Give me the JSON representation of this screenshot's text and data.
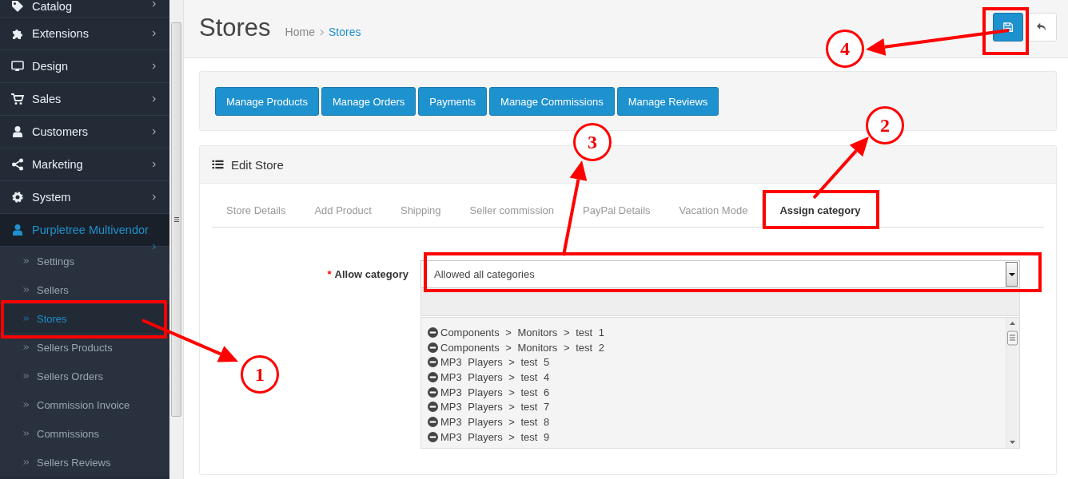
{
  "sidebar": {
    "items": [
      {
        "label": "Catalog",
        "selected": false
      },
      {
        "label": "Extensions",
        "selected": false
      },
      {
        "label": "Design",
        "selected": false
      },
      {
        "label": "Sales",
        "selected": false
      },
      {
        "label": "Customers",
        "selected": false
      },
      {
        "label": "Marketing",
        "selected": false
      },
      {
        "label": "System",
        "selected": false
      },
      {
        "label": "Purpletree Multivendor",
        "selected": true,
        "children": [
          {
            "label": "Settings",
            "selected": false
          },
          {
            "label": "Sellers",
            "selected": false
          },
          {
            "label": "Stores",
            "selected": true
          },
          {
            "label": "Sellers Products",
            "selected": false
          },
          {
            "label": "Sellers Orders",
            "selected": false
          },
          {
            "label": "Commission Invoice",
            "selected": false
          },
          {
            "label": "Commissions",
            "selected": false
          },
          {
            "label": "Sellers Reviews",
            "selected": false
          }
        ]
      }
    ]
  },
  "header": {
    "title": "Stores",
    "breadcrumbs": [
      {
        "label": "Home",
        "selected": false
      },
      {
        "label": "Stores",
        "selected": true
      }
    ],
    "buttons": [
      {
        "kind": "save"
      },
      {
        "kind": "back"
      }
    ]
  },
  "actions": [
    "Manage Products",
    "Manage Orders",
    "Payments",
    "Manage Commissions",
    "Manage Reviews"
  ],
  "edit_store": {
    "title": "Edit Store",
    "tabs": [
      {
        "label": "Store Details",
        "selected": false
      },
      {
        "label": "Add Product",
        "selected": false
      },
      {
        "label": "Shipping",
        "selected": false
      },
      {
        "label": "Seller commission",
        "selected": false
      },
      {
        "label": "PayPal Details",
        "selected": false
      },
      {
        "label": "Vacation Mode",
        "selected": false
      },
      {
        "label": "Assign category",
        "selected": true
      }
    ],
    "form": {
      "required_mark": "*",
      "label": "Allow category",
      "select_value": "Allowed all categories",
      "categories": [
        "Components > Monitors > test 1",
        "Components > Monitors > test 2",
        "MP3 Players > test 5",
        "MP3 Players > test 4",
        "MP3 Players > test 6",
        "MP3 Players > test 7",
        "MP3 Players > test 8",
        "MP3 Players > test 9"
      ]
    }
  },
  "annotations": [
    {
      "number": "1"
    },
    {
      "number": "2"
    },
    {
      "number": "3"
    },
    {
      "number": "4"
    }
  ]
}
